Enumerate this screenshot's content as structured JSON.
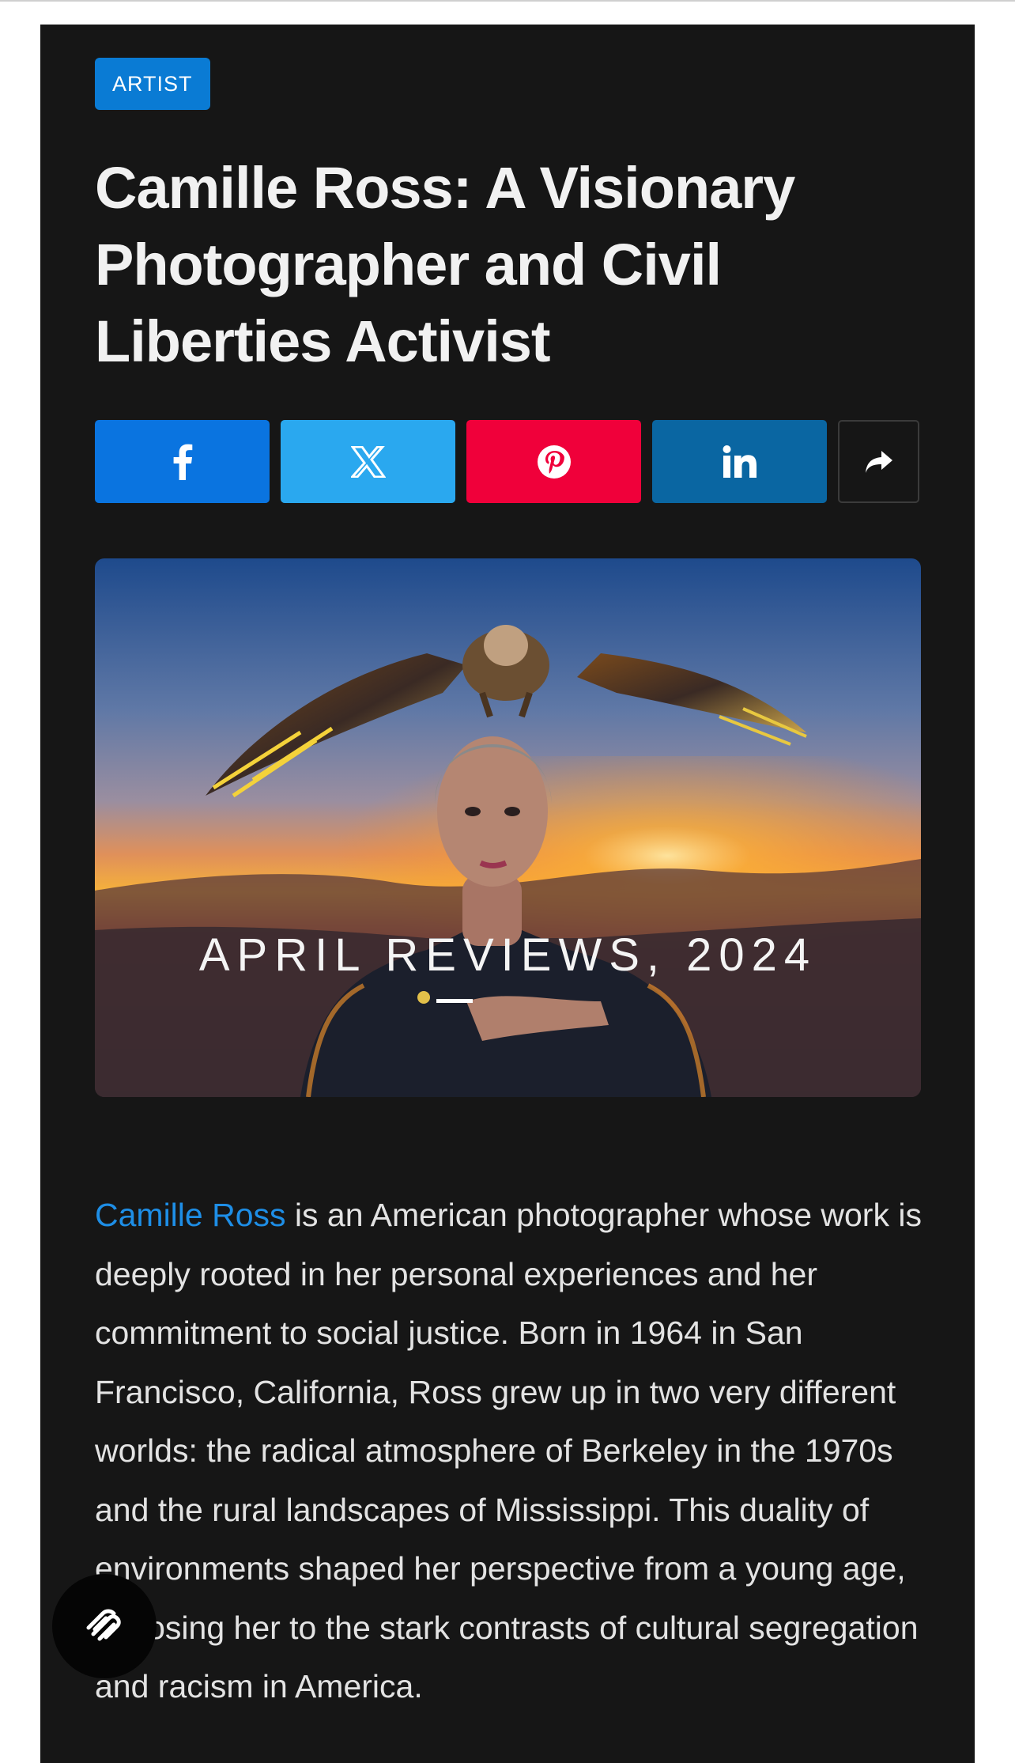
{
  "post": {
    "category": "ARTIST",
    "title": "Camille Ross: A Visionary Photographer and Civil Liberties Activist"
  },
  "share": {
    "facebook_icon": "facebook-icon",
    "x_icon": "x-icon",
    "pinterest_icon": "pinterest-icon",
    "linkedin_icon": "linkedin-icon",
    "more_icon": "share-arrow-icon",
    "colors": {
      "facebook": "#0a74e0",
      "x": "#2aa8ef",
      "pinterest": "#f0003a",
      "linkedin": "#0a66a2"
    }
  },
  "hero": {
    "caption": "APRIL REVIEWS, 2024"
  },
  "article": {
    "link_text": "Camille Ross",
    "body": " is an American photographer whose work is deeply rooted in her personal experiences and her commitment to social justice. Born in 1964 in San Francisco, California, Ross grew up in two very different worlds: the radical atmosphere of Berkeley in the 1970s and the rural landscapes of Mississippi. This duality of environments shaped her perspective from a young age, exposing her to the stark contrasts of cultural segregation and racism in America."
  },
  "fab": {
    "icon": "squarespace-logo-icon"
  }
}
